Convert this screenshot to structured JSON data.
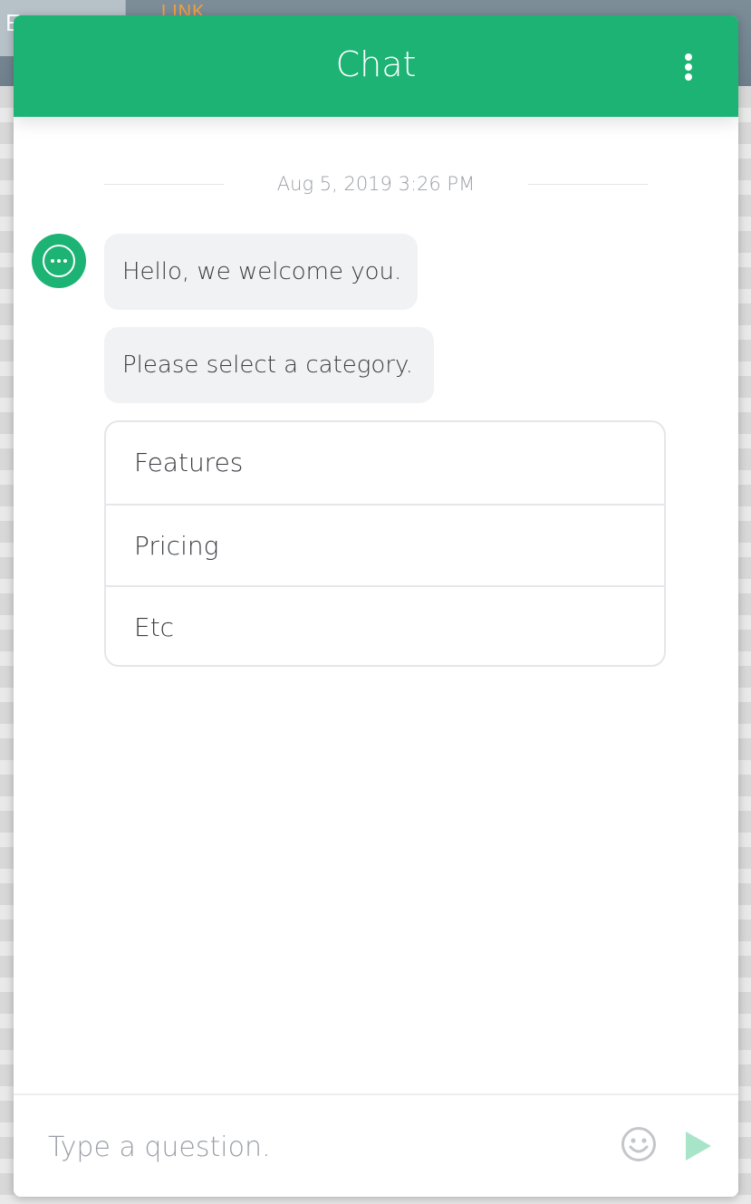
{
  "background": {
    "tab_text": "E",
    "link_text": "LINK"
  },
  "header": {
    "title": "Chat",
    "color": "#1db374"
  },
  "conversation": {
    "timestamp": "Aug 5, 2019 3:26 PM",
    "messages": [
      {
        "sender": "bot",
        "text": "Hello, we welcome you."
      },
      {
        "sender": "bot",
        "text": "Please select a category."
      }
    ],
    "options": [
      "Features",
      "Pricing",
      "Etc"
    ]
  },
  "composer": {
    "placeholder": "Type a question.",
    "emoji_icon": "smiley-face-icon",
    "send_icon": "send-triangle-icon",
    "send_color": "#a8e4c8"
  }
}
